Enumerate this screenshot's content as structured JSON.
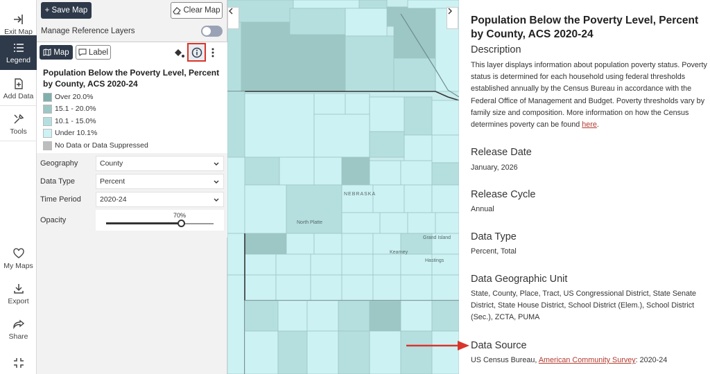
{
  "rail": {
    "exit_map": "Exit Map",
    "legend": "Legend",
    "add_data": "Add Data",
    "tools": "Tools",
    "my_maps": "My Maps",
    "export": "Export",
    "share": "Share"
  },
  "toolbar": {
    "save_map": "+ Save Map",
    "clear_map": "Clear Map"
  },
  "reference_layers": {
    "label": "Manage Reference Layers"
  },
  "layer": {
    "map_tab": "Map",
    "label_tab": "Label",
    "title": "Population Below the Poverty Level, Percent by County, ACS 2020-24",
    "legend": [
      {
        "label": "Over 20.0%",
        "color": "#7fb0ad"
      },
      {
        "label": "15.1 - 20.0%",
        "color": "#9cc7c4"
      },
      {
        "label": "10.1 - 15.0%",
        "color": "#b5dfdf"
      },
      {
        "label": "Under 10.1%",
        "color": "#cdf2f4"
      },
      {
        "label": "No Data or Data Suppressed",
        "color": "#bdbdbd"
      }
    ],
    "controls": {
      "geography_label": "Geography",
      "geography_value": "County",
      "data_type_label": "Data Type",
      "data_type_value": "Percent",
      "time_period_label": "Time Period",
      "time_period_value": "2020-24",
      "opacity_label": "Opacity",
      "opacity_value": "70%",
      "opacity_fraction": 0.7
    }
  },
  "map": {
    "state_label": "NEBRASKA",
    "cities": [
      "North Platte",
      "Grand Island",
      "Kearney",
      "Hastings"
    ]
  },
  "info": {
    "title": "Population Below the Poverty Level, Percent by County, ACS 2020-24",
    "description_head": "Description",
    "description_text": "This layer displays information about population poverty status. Poverty status is determined for each household using federal thresholds established annually by the Census Bureau in accordance with the Federal Office of Management and Budget. Poverty thresholds vary by family size and composition. More information on how the Census determines poverty can be found",
    "description_link": "here",
    "release_date_head": "Release Date",
    "release_date_value": "January, 2026",
    "release_cycle_head": "Release Cycle",
    "release_cycle_value": "Annual",
    "data_type_head": "Data Type",
    "data_type_value": "Percent, Total",
    "geo_unit_head": "Data Geographic Unit",
    "geo_unit_value": "State, County, Place, Tract, US Congressional District, State Senate District, State House District, School District (Elem.), School District (Sec.), ZCTA, PUMA",
    "data_source_head": "Data Source",
    "data_source_prefix": "US Census Bureau,",
    "data_source_link": "American Community Survey",
    "data_source_suffix": ": 2020-24"
  },
  "colors": {
    "accent": "#2e3a4a",
    "highlight": "#d9352a",
    "link": "#b33a2e"
  }
}
